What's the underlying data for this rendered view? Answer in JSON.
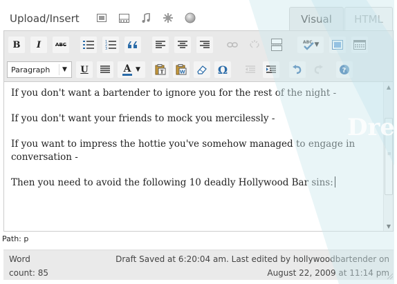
{
  "header": {
    "upload_label": "Upload/Insert",
    "media_icons": [
      "image-icon",
      "video-icon",
      "audio-icon",
      "media-icon",
      "circle-icon"
    ],
    "tabs": [
      {
        "label": "Visual",
        "active": true
      },
      {
        "label": "HTML",
        "active": false
      }
    ]
  },
  "toolbar": {
    "row1": [
      "bold",
      "italic",
      "strikethrough",
      "unordered-list",
      "ordered-list",
      "blockquote",
      "align-left",
      "align-center",
      "align-right",
      "link",
      "unlink",
      "insert-more",
      "spellcheck",
      "fullscreen",
      "kitchen-sink"
    ],
    "bold_label": "B",
    "italic_label": "I",
    "strike_label": "ABC",
    "format_select": "Paragraph",
    "underline_label": "U",
    "text_color_label": "A",
    "special_char_label": "Ω"
  },
  "content": {
    "paragraphs": [
      "If you don't want a bartender to ignore you for the rest of the night -",
      "If you don't want your friends to mock you mercilessly -",
      "If you want to impress the hottie you've somehow managed to engage in conversation -",
      "Then you need to avoid the following 10 deadly Hollywood Bar sins:"
    ],
    "watermark": "Dre"
  },
  "path": {
    "text": "Path: p"
  },
  "status": {
    "word_label": "Word",
    "count_label": "count: 85",
    "draft_line1": "Draft Saved at 6:20:04 am. Last edited by hollywoodbartender on",
    "draft_line2": "August 22, 2009 at 11:14 pm"
  },
  "colors": {
    "toolbar_bg": "#e9e9e9",
    "watermark": "#cfe9ee",
    "link_blue": "#2a6ba8"
  }
}
